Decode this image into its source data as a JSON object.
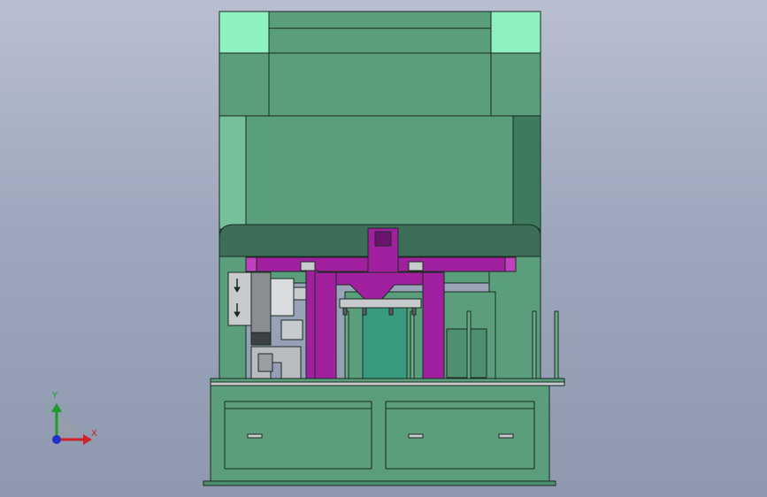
{
  "viewport": {
    "background_top": "#b8bfd0",
    "background_bottom": "#8e98ae"
  },
  "colors": {
    "frame_green": "#5a9e7c",
    "frame_green_dark": "#3d6e57",
    "frame_light_mint": "#8ff0c0",
    "robot_magenta": "#a020a0",
    "robot_magenta_dark": "#6a1470",
    "metal_gray": "#c8cbce",
    "teal_plate": "#3a9a80",
    "outline": "#1c2a22"
  },
  "triad": {
    "x_label": "X",
    "y_label": "Y",
    "x_color": "#d0202a",
    "y_color": "#1d9a2b",
    "z_color": "#2030c8"
  },
  "icons": {
    "triad": "coordinate-triad-icon"
  }
}
